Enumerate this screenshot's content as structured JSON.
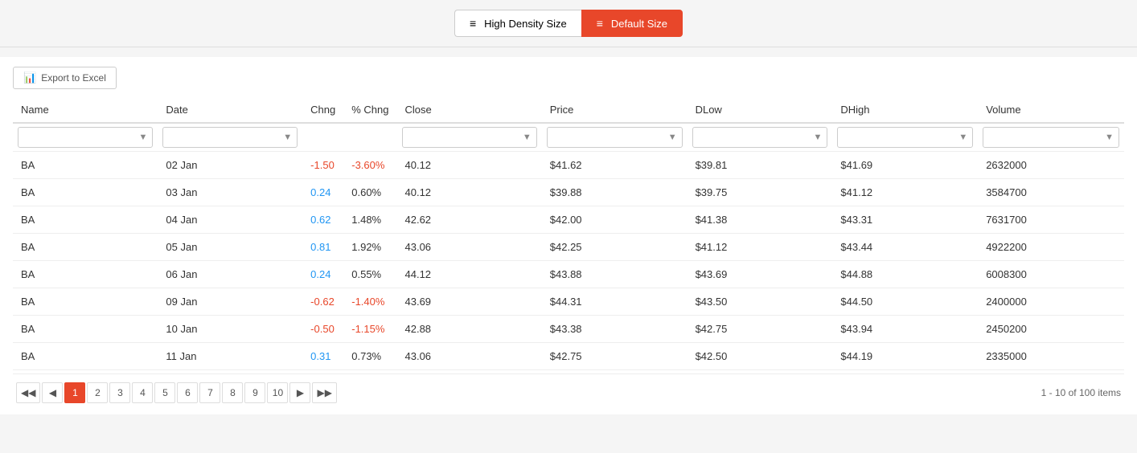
{
  "toolbar": {
    "high_density_label": "High Density Size",
    "default_size_label": "Default Size",
    "export_label": "Export to Excel"
  },
  "table": {
    "columns": [
      "Name",
      "Date",
      "Chng",
      "% Chng",
      "Close",
      "Price",
      "DLow",
      "DHigh",
      "Volume"
    ],
    "rows": [
      {
        "name": "BA",
        "date": "02 Jan",
        "chng": "-1.50",
        "chng_pct": "-3.60%",
        "close": "40.12",
        "price": "$41.62",
        "dlow": "$39.81",
        "dhigh": "$41.69",
        "volume": "2632000",
        "chng_neg": true,
        "pct_neg": true
      },
      {
        "name": "BA",
        "date": "03 Jan",
        "chng": "0.24",
        "chng_pct": "0.60%",
        "close": "40.12",
        "price": "$39.88",
        "dlow": "$39.75",
        "dhigh": "$41.12",
        "volume": "3584700",
        "chng_neg": false,
        "pct_neg": false
      },
      {
        "name": "BA",
        "date": "04 Jan",
        "chng": "0.62",
        "chng_pct": "1.48%",
        "close": "42.62",
        "price": "$42.00",
        "dlow": "$41.38",
        "dhigh": "$43.31",
        "volume": "7631700",
        "chng_neg": false,
        "pct_neg": false
      },
      {
        "name": "BA",
        "date": "05 Jan",
        "chng": "0.81",
        "chng_pct": "1.92%",
        "close": "43.06",
        "price": "$42.25",
        "dlow": "$41.12",
        "dhigh": "$43.44",
        "volume": "4922200",
        "chng_neg": false,
        "pct_neg": false
      },
      {
        "name": "BA",
        "date": "06 Jan",
        "chng": "0.24",
        "chng_pct": "0.55%",
        "close": "44.12",
        "price": "$43.88",
        "dlow": "$43.69",
        "dhigh": "$44.88",
        "volume": "6008300",
        "chng_neg": false,
        "pct_neg": false
      },
      {
        "name": "BA",
        "date": "09 Jan",
        "chng": "-0.62",
        "chng_pct": "-1.40%",
        "close": "43.69",
        "price": "$44.31",
        "dlow": "$43.50",
        "dhigh": "$44.50",
        "volume": "2400000",
        "chng_neg": true,
        "pct_neg": true
      },
      {
        "name": "BA",
        "date": "10 Jan",
        "chng": "-0.50",
        "chng_pct": "-1.15%",
        "close": "42.88",
        "price": "$43.38",
        "dlow": "$42.75",
        "dhigh": "$43.94",
        "volume": "2450200",
        "chng_neg": true,
        "pct_neg": true
      },
      {
        "name": "BA",
        "date": "11 Jan",
        "chng": "0.31",
        "chng_pct": "0.73%",
        "close": "43.06",
        "price": "$42.75",
        "dlow": "$42.50",
        "dhigh": "$44.19",
        "volume": "2335000",
        "chng_neg": false,
        "pct_neg": false
      }
    ]
  },
  "pagination": {
    "pages": [
      "1",
      "2",
      "3",
      "4",
      "5",
      "6",
      "7",
      "8",
      "9",
      "10"
    ],
    "active_page": "1",
    "summary": "1 - 10 of 100 items"
  }
}
